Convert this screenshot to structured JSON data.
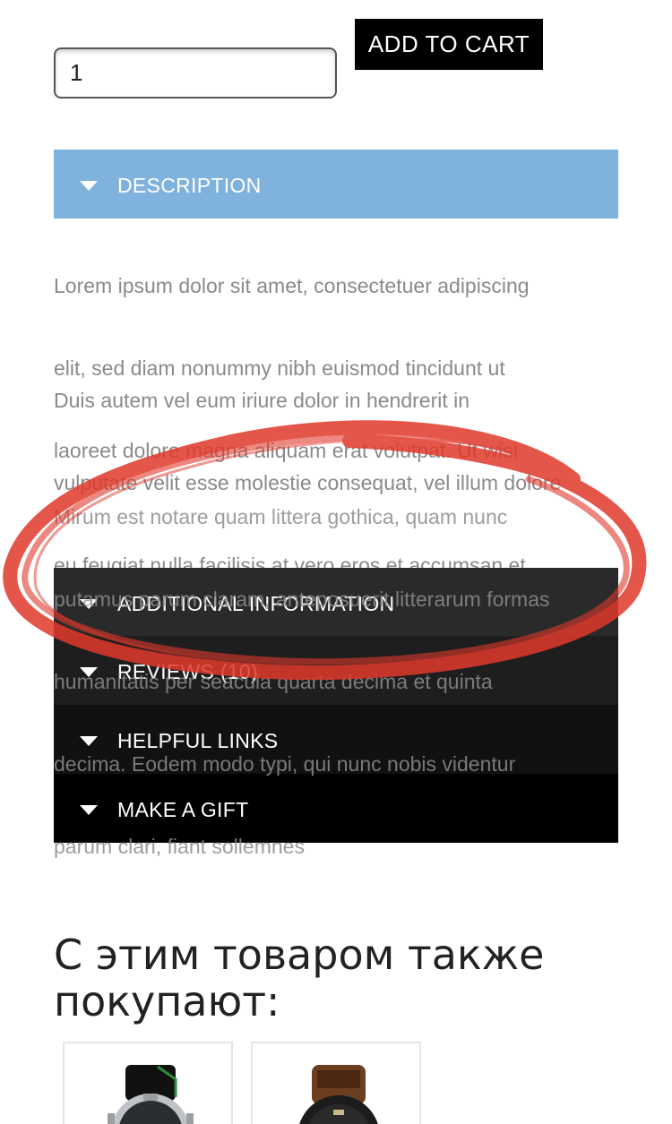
{
  "cart": {
    "quantity": "1",
    "add_to_cart_label": "ADD TO CART"
  },
  "accordion": {
    "description": {
      "label": "DESCRIPTION",
      "paragraph1": [
        "Lorem ipsum dolor sit amet, consectetuer adipiscing",
        "elit, sed diam nonummy nibh euismod tincidunt ut",
        "laoreet dolore magna aliquam erat volutpat. Ut wisi"
      ],
      "paragraph2": [
        "Duis autem vel eum iriure dolor in hendrerit in",
        "vulputate velit esse molestie consequat, vel illum dolore",
        "eu feugiat nulla facilisis at vero eros et accumsan et"
      ],
      "paragraph3": [
        "Mirum est notare quam littera gothica, quam nunc",
        "putamus parum claram, anteposuerit litterarum formas",
        "humanitatis per seacula quarta decima et quinta",
        "decima. Eodem modo typi, qui nunc nobis videntur",
        "parum clari, fiant sollemnes"
      ]
    },
    "additional_information": {
      "label": "ADDITIONAL INFORMATION"
    },
    "reviews": {
      "label": "REVIEWS (10)"
    },
    "helpful_links": {
      "label": "HELPFUL LINKS"
    },
    "make_a_gift": {
      "label": "MAKE A GIFT"
    }
  },
  "related": {
    "title_line1": "С этим товаром также",
    "title_line2": "покупают:",
    "products": [
      {
        "icon": "wristwatch-silver-black-strap-icon"
      },
      {
        "icon": "wristwatch-black-brown-strap-icon"
      }
    ]
  },
  "colors": {
    "description_header": "#7fb2dc",
    "annotation_red": "#e0392b",
    "button_black": "#000000"
  }
}
